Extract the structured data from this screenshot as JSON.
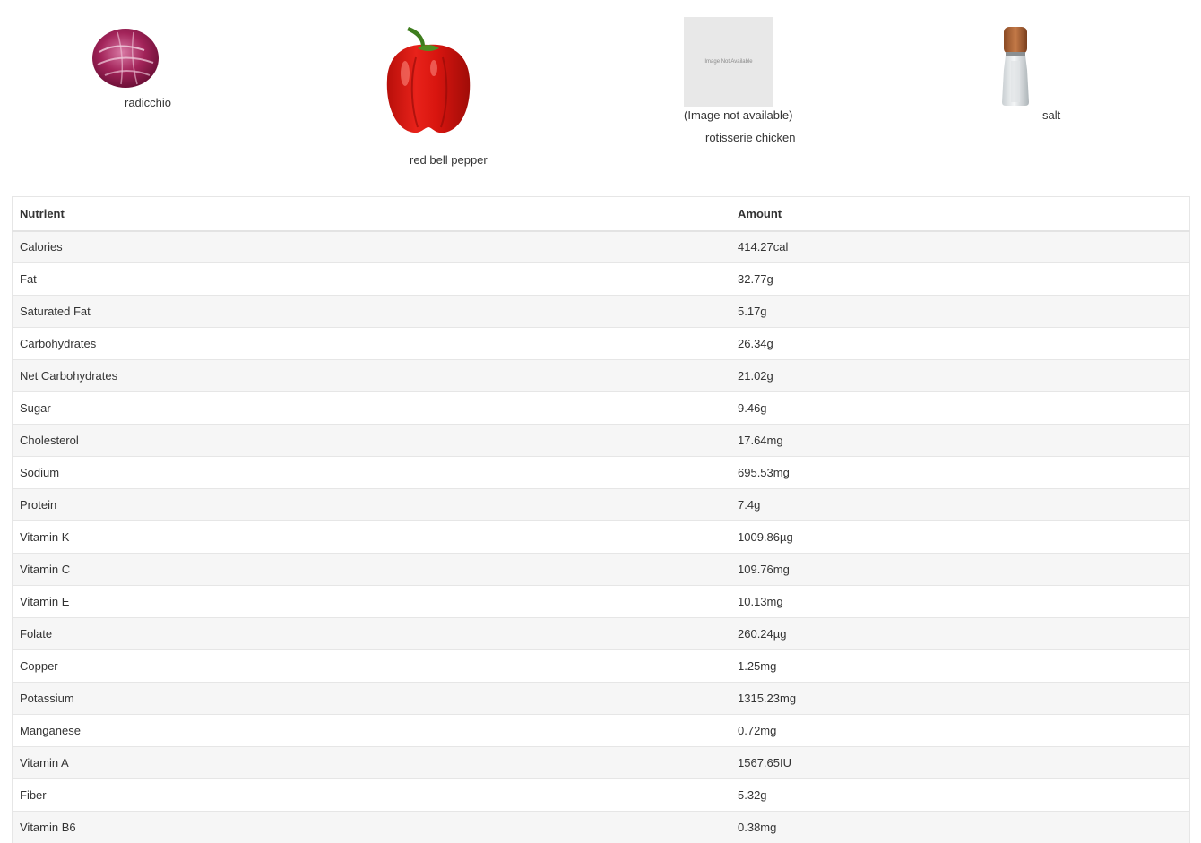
{
  "ingredients": {
    "radicchio": {
      "name": "radicchio"
    },
    "red_bell_pepper": {
      "name": "red bell pepper"
    },
    "rotisserie_chicken": {
      "name": "rotisserie chicken",
      "unavailable_note": "(Image not available)",
      "placeholder_text": "Image Not Available"
    },
    "salt": {
      "name": "salt"
    }
  },
  "table": {
    "headers": {
      "nutrient": "Nutrient",
      "amount": "Amount"
    },
    "rows": [
      {
        "nutrient": "Calories",
        "amount": "414.27cal"
      },
      {
        "nutrient": "Fat",
        "amount": "32.77g"
      },
      {
        "nutrient": "Saturated Fat",
        "amount": "5.17g"
      },
      {
        "nutrient": "Carbohydrates",
        "amount": "26.34g"
      },
      {
        "nutrient": "Net Carbohydrates",
        "amount": "21.02g"
      },
      {
        "nutrient": "Sugar",
        "amount": "9.46g"
      },
      {
        "nutrient": "Cholesterol",
        "amount": "17.64mg"
      },
      {
        "nutrient": "Sodium",
        "amount": "695.53mg"
      },
      {
        "nutrient": "Protein",
        "amount": "7.4g"
      },
      {
        "nutrient": "Vitamin K",
        "amount": "1009.86µg"
      },
      {
        "nutrient": "Vitamin C",
        "amount": "109.76mg"
      },
      {
        "nutrient": "Vitamin E",
        "amount": "10.13mg"
      },
      {
        "nutrient": "Folate",
        "amount": "260.24µg"
      },
      {
        "nutrient": "Copper",
        "amount": "1.25mg"
      },
      {
        "nutrient": "Potassium",
        "amount": "1315.23mg"
      },
      {
        "nutrient": "Manganese",
        "amount": "0.72mg"
      },
      {
        "nutrient": "Vitamin A",
        "amount": "1567.65IU"
      },
      {
        "nutrient": "Fiber",
        "amount": "5.32g"
      },
      {
        "nutrient": "Vitamin B6",
        "amount": "0.38mg"
      }
    ]
  }
}
